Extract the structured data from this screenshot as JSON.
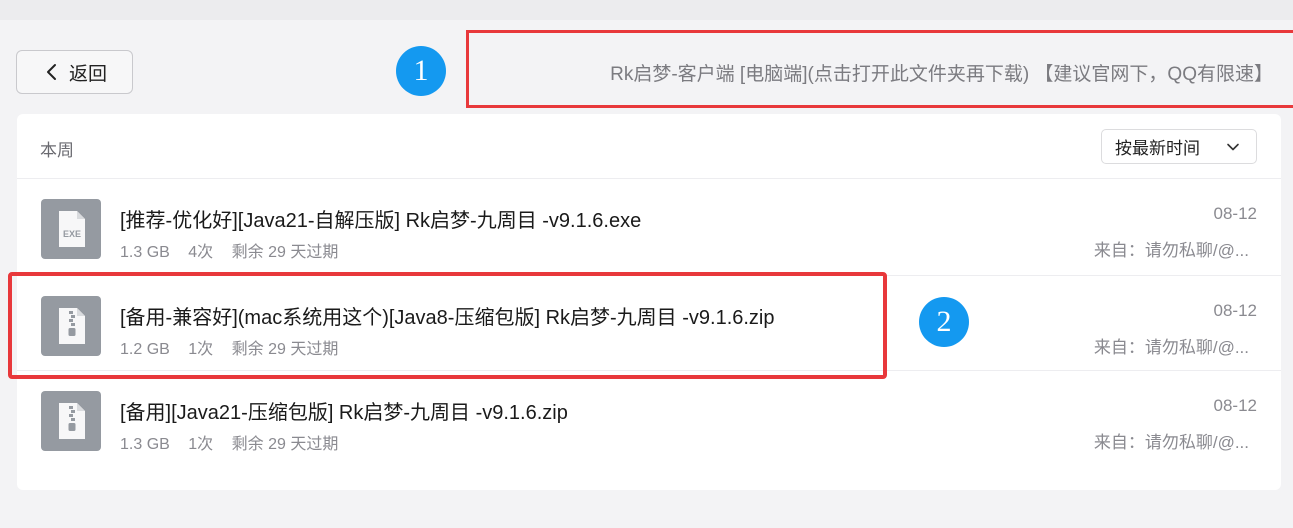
{
  "back_button": {
    "label": "返回"
  },
  "annotations": {
    "badge_1": "1",
    "badge_2": "2"
  },
  "folder": {
    "title": "Rk启梦-客户端 [电脑端](点击打开此文件夹再下载) 【建议官网下，QQ有限速】"
  },
  "list": {
    "group_label": "本周",
    "sort_label": "按最新时间",
    "files": [
      {
        "name": "[推荐-优化好][Java21-自解压版] Rk启梦-九周目 -v9.1.6.exe",
        "size": "1.3 GB",
        "count": "4次",
        "expiry": "剩余 29 天过期",
        "date": "08-12",
        "from": "来自：请勿私聊/@...",
        "icon": "exe-file-icon",
        "icon_text": "EXE"
      },
      {
        "name": "[备用-兼容好](mac系统用这个)[Java8-压缩包版] Rk启梦-九周目 -v9.1.6.zip",
        "size": "1.2 GB",
        "count": "1次",
        "expiry": "剩余 29 天过期",
        "date": "08-12",
        "from": "来自：请勿私聊/@...",
        "icon": "zip-file-icon"
      },
      {
        "name": "[备用][Java21-压缩包版] Rk启梦-九周目 -v9.1.6.zip",
        "size": "1.3 GB",
        "count": "1次",
        "expiry": "剩余 29 天过期",
        "date": "08-12",
        "from": "来自：请勿私聊/@...",
        "icon": "zip-file-icon"
      }
    ]
  },
  "colors": {
    "accent_blue": "#1499f0",
    "highlight_red": "#e8383b",
    "file_icon_gray": "#959aa1"
  }
}
